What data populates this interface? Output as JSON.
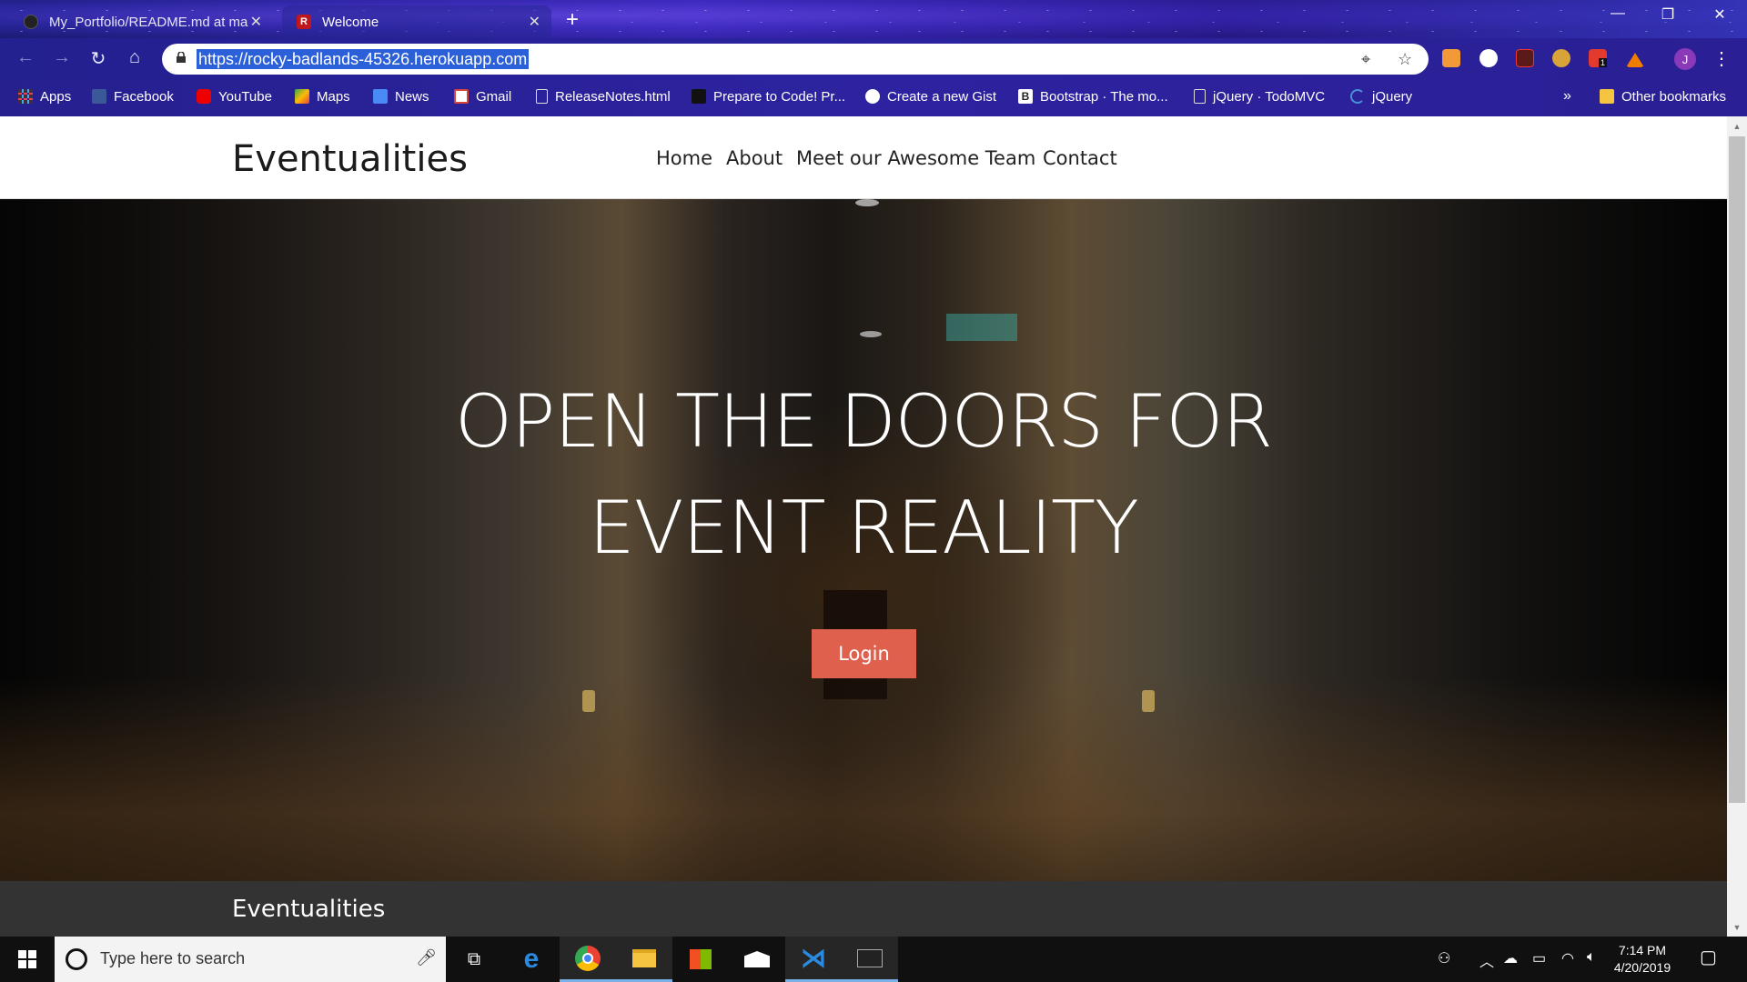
{
  "browser": {
    "tabs": [
      {
        "title": "My_Portfolio/README.md at ma",
        "active": false
      },
      {
        "title": "Welcome",
        "active": true
      }
    ],
    "url": "https://rocky-badlands-45326.herokuapp.com",
    "bookmarks": [
      {
        "label": "Apps",
        "icon": "apps-grid-icon"
      },
      {
        "label": "Facebook",
        "icon": "facebook-icon"
      },
      {
        "label": "YouTube",
        "icon": "youtube-icon"
      },
      {
        "label": "Maps",
        "icon": "maps-icon"
      },
      {
        "label": "News",
        "icon": "news-icon"
      },
      {
        "label": "Gmail",
        "icon": "gmail-icon"
      },
      {
        "label": "ReleaseNotes.html",
        "icon": "page-icon"
      },
      {
        "label": "Prepare to Code! Pr...",
        "icon": "freecodecamp-icon"
      },
      {
        "label": "Create a new Gist",
        "icon": "github-icon"
      },
      {
        "label": "Bootstrap · The mo...",
        "icon": "bootstrap-icon"
      },
      {
        "label": "jQuery · TodoMVC",
        "icon": "page-icon"
      },
      {
        "label": "jQuery",
        "icon": "jquery-icon"
      }
    ],
    "overflow_label": "»",
    "other_bookmarks": "Other bookmarks",
    "profile_initial": "J",
    "extension_badge": "1"
  },
  "site": {
    "brand": "Eventualities",
    "nav": [
      "Home",
      "About",
      "Meet our Awesome Team",
      "Contact"
    ],
    "hero_line1": "OPEN THE DOORS FOR",
    "hero_line2": "EVENT REALITY",
    "login_label": "Login",
    "footer_brand": "Eventualities"
  },
  "taskbar": {
    "search_placeholder": "Type here to search",
    "time": "7:14 PM",
    "date": "4/20/2019"
  },
  "colors": {
    "accent_button": "#e0604e",
    "url_highlight": "#2b60d8",
    "footer_bg": "#333333"
  }
}
